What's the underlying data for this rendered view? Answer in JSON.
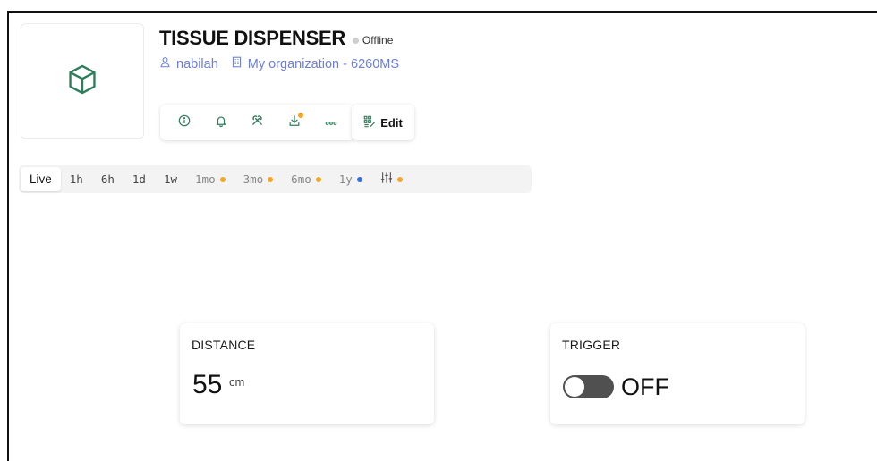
{
  "device": {
    "name": "TISSUE DISPENSER",
    "status": "Offline",
    "owner": "nabilah",
    "organization": "My organization - 6260MS",
    "thumbnail_icon": "cube-icon"
  },
  "toolbar": {
    "buttons": [
      {
        "name": "info-button",
        "icon": "info-icon"
      },
      {
        "name": "notifications-button",
        "icon": "bell-icon"
      },
      {
        "name": "tools-button",
        "icon": "tools-icon"
      },
      {
        "name": "download-button",
        "icon": "download-icon",
        "badge": true
      },
      {
        "name": "more-button",
        "icon": "more-icon"
      }
    ],
    "edit_label": "Edit"
  },
  "ranges": [
    {
      "label": "Live",
      "active": true
    },
    {
      "label": "1h"
    },
    {
      "label": "6h"
    },
    {
      "label": "1d"
    },
    {
      "label": "1w"
    },
    {
      "label": "1mo",
      "dot": "#f5a623",
      "dim": true
    },
    {
      "label": "3mo",
      "dot": "#f5a623",
      "dim": true
    },
    {
      "label": "6mo",
      "dot": "#f5a623",
      "dim": true
    },
    {
      "label": "1y",
      "dot": "#2f6fe0",
      "dim": true
    },
    {
      "label": "",
      "icon": "sliders-icon",
      "dot": "#f5a623"
    }
  ],
  "widgets": {
    "distance": {
      "title": "DISTANCE",
      "value": "55",
      "unit": "cm"
    },
    "trigger": {
      "title": "TRIGGER",
      "state": "OFF"
    }
  },
  "colors": {
    "accent_green": "#2e7d5b",
    "link_blue": "#6b7fd6",
    "badge_orange": "#f5a623",
    "badge_blue": "#2f6fe0"
  }
}
